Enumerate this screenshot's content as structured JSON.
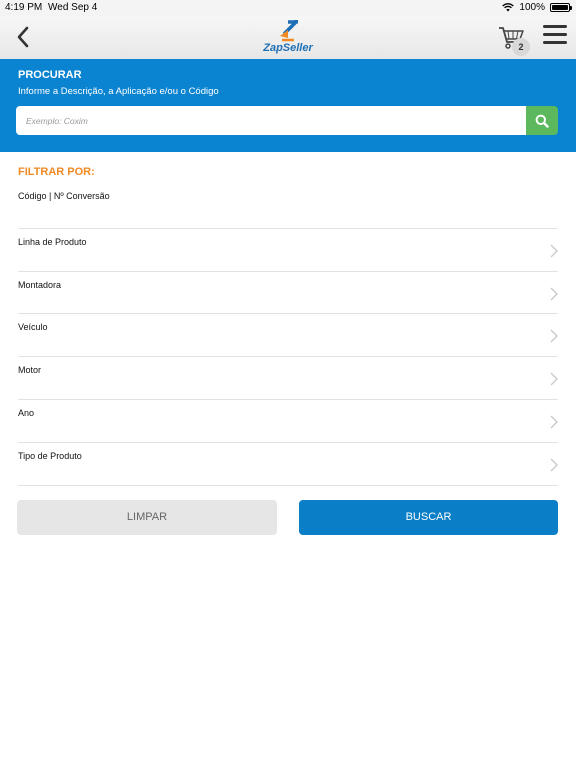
{
  "status_bar": {
    "time": "4:19 PM",
    "date": "Wed Sep 4",
    "battery": "100%",
    "icons": [
      "wifi-icon",
      "battery-icon"
    ]
  },
  "header": {
    "logo_text": "ZapSeller",
    "cart_count": "2",
    "icons": [
      "back-chevron-icon",
      "cart-icon",
      "hamburger-menu-icon"
    ]
  },
  "search": {
    "title": "PROCURAR",
    "subtitle": "Informe a Descrição, a Aplicação e/ou o Código",
    "placeholder": "Exemplo: Coxim",
    "value": "",
    "icon": "search-icon"
  },
  "filters": {
    "title": "FILTRAR POR:",
    "code_label": "Código | Nº Conversão",
    "items": [
      {
        "label": "Linha de Produto"
      },
      {
        "label": "Montadora"
      },
      {
        "label": "Veículo"
      },
      {
        "label": "Motor"
      },
      {
        "label": "Ano"
      },
      {
        "label": "Tipo de Produto"
      }
    ]
  },
  "actions": {
    "clear_label": "LIMPAR",
    "search_label": "BUSCAR"
  },
  "colors": {
    "primary_blue": "#0a84d0",
    "accent_orange": "#f08a24",
    "search_green": "#5cb85c",
    "clear_gray": "#e6e6e6"
  }
}
